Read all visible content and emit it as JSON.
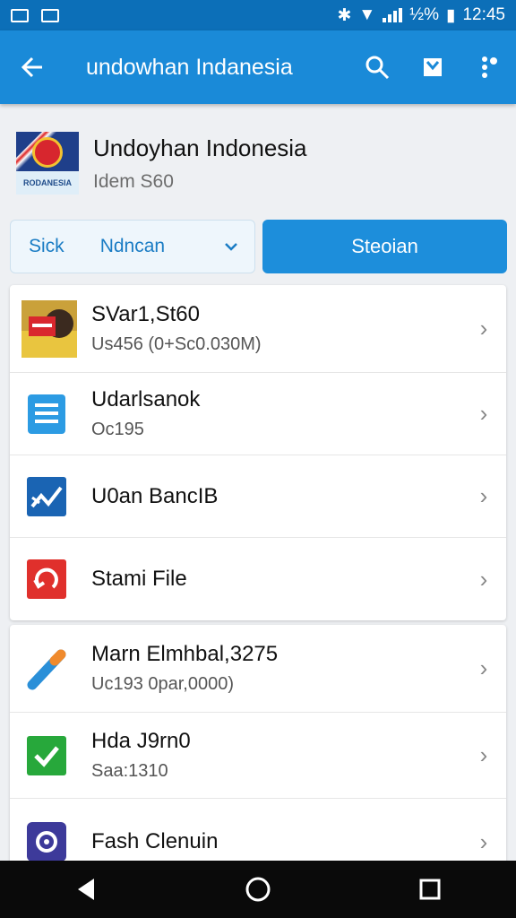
{
  "status_bar": {
    "time": "12:45",
    "battery": "½%"
  },
  "app_bar": {
    "title": "undowhan Indanesia"
  },
  "header": {
    "name": "Undoyhan Indonesia",
    "subtitle": "Idem S60",
    "flag_text": "RODANESIA"
  },
  "actions": {
    "dropdown_prefix": "Sick",
    "dropdown_value": "Ndncan",
    "primary_label": "Steoian"
  },
  "list_group_1": [
    {
      "title": "SVar1,St60",
      "subtitle": "Us456 (0+Sc0.030M)",
      "icon": "thumbnail-image-icon"
    },
    {
      "title": "Udarlsanok",
      "subtitle": "Oc195",
      "icon": "document-icon"
    },
    {
      "title": "U0an BancIB",
      "subtitle": "",
      "icon": "chart-icon"
    },
    {
      "title": "Stami File",
      "subtitle": "",
      "icon": "refresh-file-icon"
    }
  ],
  "list_group_2": [
    {
      "title": "Marn Elmhbal,3275",
      "subtitle": "Uc193 0par,0000)",
      "icon": "pen-icon"
    },
    {
      "title": "Hda J9rn0",
      "subtitle": "Saa:1310",
      "icon": "check-icon"
    },
    {
      "title": "Fash Clenuin",
      "subtitle": "",
      "icon": "target-icon"
    }
  ],
  "colors": {
    "status_bar": "#0c6fb8",
    "app_bar": "#1a8ad8",
    "accent": "#1d8edb"
  }
}
